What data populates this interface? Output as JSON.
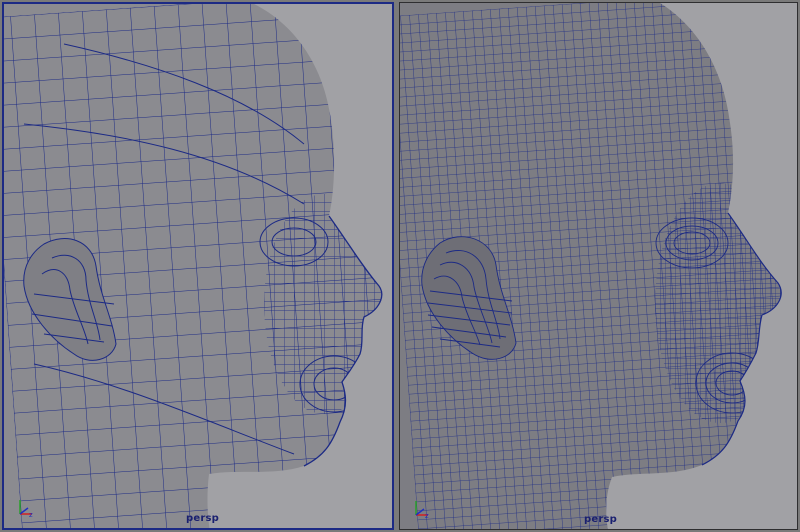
{
  "viewports": [
    {
      "camera": "persp",
      "active": true,
      "density": "low"
    },
    {
      "camera": "persp",
      "active": false,
      "density": "high"
    }
  ],
  "axis_labels": {
    "x": "x",
    "y": "y",
    "z": "z"
  },
  "colors": {
    "viewport_bg": "#a1a1a5",
    "mesh_fill": "#8b8b90",
    "wireframe": "#1c2a85",
    "active_border": "#1c2a85",
    "axis_x": "#d22020",
    "axis_y": "#2aa02a",
    "axis_z": "#2030c0"
  },
  "icons": [
    "axis-gizmo-icon"
  ]
}
